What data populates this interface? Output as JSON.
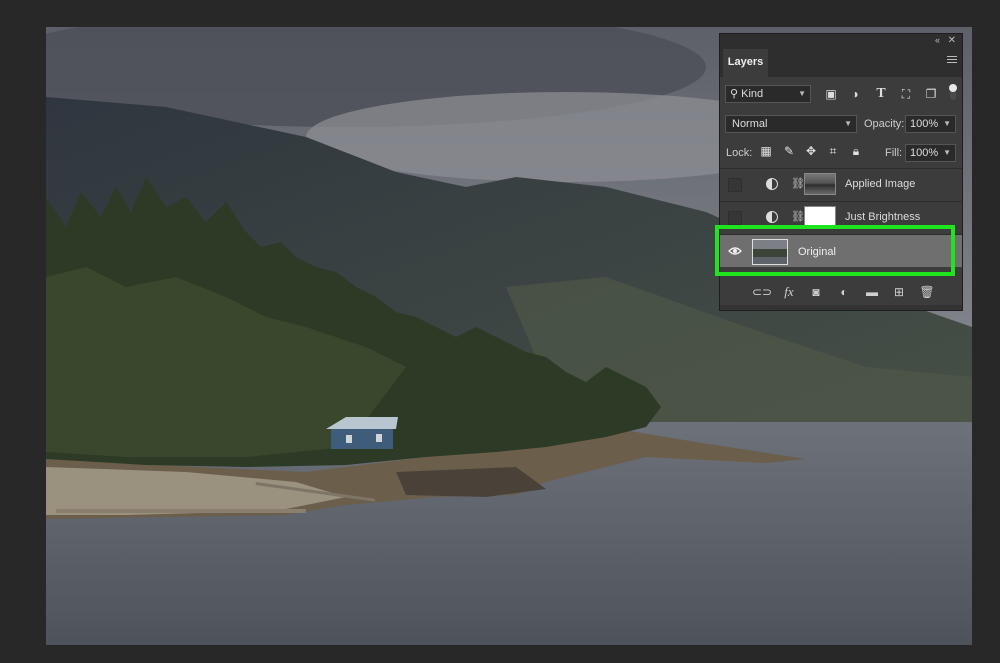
{
  "panel": {
    "tab_label": "Layers",
    "collapse_glyph": "«",
    "close_glyph": "✕",
    "filter": {
      "kind_label": "Kind",
      "icons": [
        "image-filter-icon",
        "adjustment-filter-icon",
        "type-filter-icon",
        "shape-filter-icon",
        "smart-object-filter-icon"
      ]
    },
    "blend_mode": "Normal",
    "opacity_label": "Opacity:",
    "opacity_value": "100%",
    "lock_label": "Lock:",
    "fill_label": "Fill:",
    "fill_value": "100%",
    "layers": [
      {
        "name": "Applied Image",
        "visible": false,
        "type": "adjustment"
      },
      {
        "name": "Just Brightness",
        "visible": false,
        "type": "adjustment"
      },
      {
        "name": "Original",
        "visible": true,
        "type": "pixel",
        "selected": true
      }
    ],
    "footer_icons": [
      "link-layers-icon",
      "fx-icon",
      "layer-mask-icon",
      "new-adjustment-icon",
      "new-group-icon",
      "new-layer-icon",
      "delete-layer-icon"
    ]
  },
  "colors": {
    "highlight": "#1ee51e",
    "panel_bg": "#3c3c3c",
    "workspace_bg": "#282828"
  }
}
